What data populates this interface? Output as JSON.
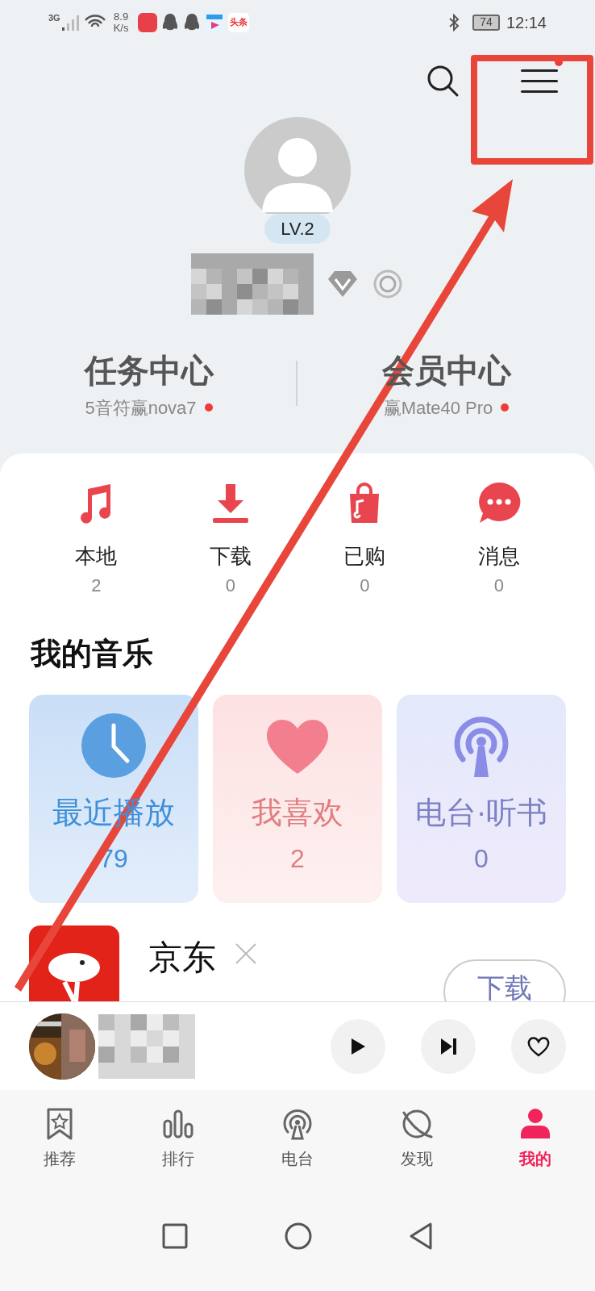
{
  "status_bar": {
    "network": "3G",
    "speed_value": "8.9",
    "speed_unit": "K/s",
    "app_label": "头条",
    "battery": "74",
    "time": "12:14"
  },
  "header": {
    "menu_badge": true
  },
  "profile": {
    "level": "LV.2"
  },
  "centers": [
    {
      "title": "任务中心",
      "subtitle": "5音符赢nova7",
      "badge": true
    },
    {
      "title": "会员中心",
      "subtitle": "赢Mate40 Pro",
      "badge": true
    }
  ],
  "shortcuts": [
    {
      "kind": "local",
      "label": "本地",
      "count": "2"
    },
    {
      "kind": "download",
      "label": "下载",
      "count": "0"
    },
    {
      "kind": "purchased",
      "label": "已购",
      "count": "0"
    },
    {
      "kind": "messages",
      "label": "消息",
      "count": "0"
    }
  ],
  "my_music": {
    "title": "我的音乐",
    "cards": [
      {
        "kind": "recent",
        "label": "最近播放",
        "count": "79"
      },
      {
        "kind": "liked",
        "label": "我喜欢",
        "count": "2"
      },
      {
        "kind": "radio",
        "label": "电台·听书",
        "count": "0"
      }
    ]
  },
  "ad": {
    "title": "京东",
    "button": "下载"
  },
  "tabs": [
    {
      "kind": "recommend",
      "label": "推荐",
      "selected": false
    },
    {
      "kind": "charts",
      "label": "排行",
      "selected": false
    },
    {
      "kind": "radio",
      "label": "电台",
      "selected": false
    },
    {
      "kind": "discover",
      "label": "发现",
      "selected": false
    },
    {
      "kind": "mine",
      "label": "我的",
      "selected": true
    }
  ]
}
